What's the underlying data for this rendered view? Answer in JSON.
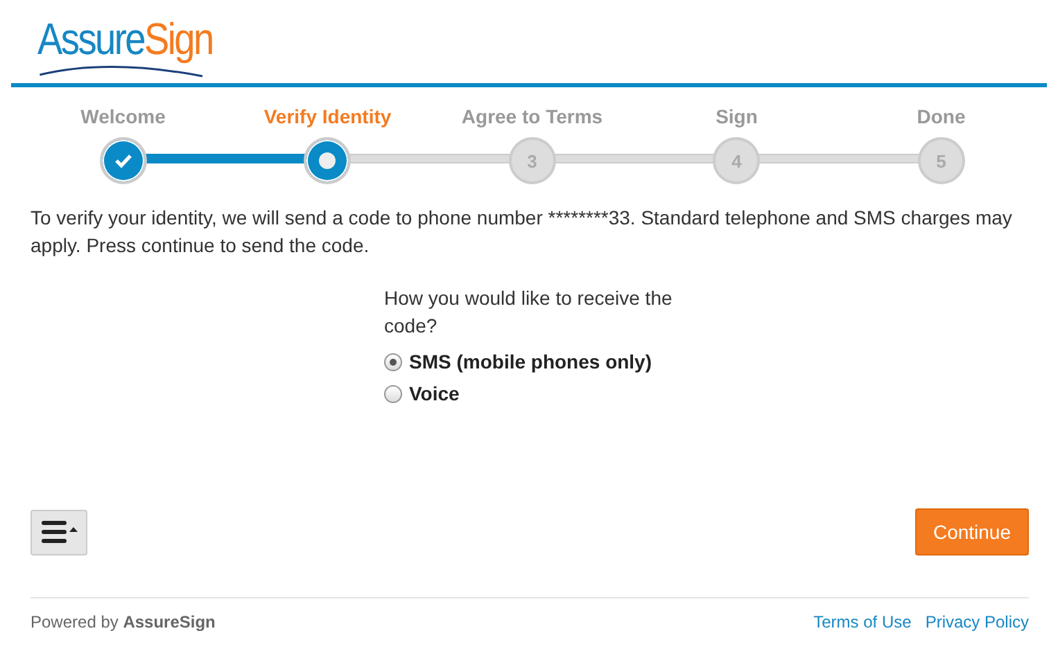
{
  "logo": {
    "first": "Assure",
    "second": "Sign"
  },
  "steps": [
    {
      "label": "Welcome",
      "completed": true,
      "current": false
    },
    {
      "label": "Verify Identity",
      "completed": false,
      "current": true
    },
    {
      "label": "Agree to Terms",
      "completed": false,
      "current": false,
      "number": "3"
    },
    {
      "label": "Sign",
      "completed": false,
      "current": false,
      "number": "4"
    },
    {
      "label": "Done",
      "completed": false,
      "current": false,
      "number": "5"
    }
  ],
  "message": "To verify your identity, we will send a code to phone number ********33. Standard telephone and SMS charges may apply. Press continue to send the code.",
  "question": "How you would like to receive the code?",
  "options": [
    {
      "label": "SMS (mobile phones only)",
      "selected": true
    },
    {
      "label": "Voice",
      "selected": false
    }
  ],
  "continue_button": "Continue",
  "footer": {
    "powered_by": "Powered by **AssureSign**",
    "links": [
      "Terms of Use",
      "Privacy Policy"
    ]
  }
}
